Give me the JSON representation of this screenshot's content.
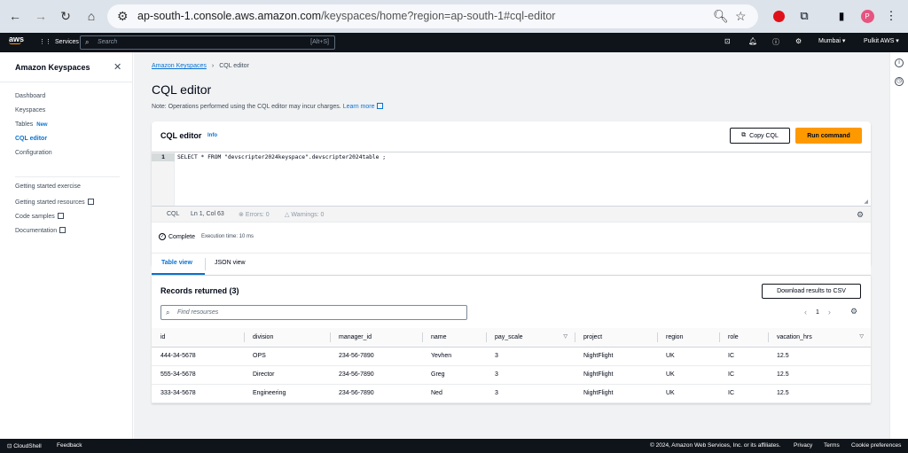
{
  "browser": {
    "url_host": "ap-south-1.console.aws.amazon.com",
    "url_path": "/keyspaces/home?region=ap-south-1#cql-editor",
    "profile_initial": "P"
  },
  "awsnav": {
    "logo": "aws",
    "services_label": "Services",
    "search_placeholder": "Search",
    "search_shortcut": "[Alt+S]",
    "region": "Mumbai ▾",
    "account": "Pulkit AWS ▾"
  },
  "sidepanel": {
    "title": "Amazon Keyspaces",
    "items": [
      {
        "label": "Dashboard"
      },
      {
        "label": "Keyspaces"
      },
      {
        "label": "Tables",
        "badge": "New"
      },
      {
        "label": "CQL editor"
      },
      {
        "label": "Configuration"
      }
    ],
    "links": [
      {
        "label": "Getting started exercise"
      },
      {
        "label": "Getting started resources"
      },
      {
        "label": "Code samples"
      },
      {
        "label": "Documentation"
      }
    ]
  },
  "breadcrumb": {
    "parent": "Amazon Keyspaces",
    "current": "CQL editor"
  },
  "page": {
    "title": "CQL editor",
    "note": "Note: Operations performed using the CQL editor may incur charges.",
    "learn_more": "Learn more"
  },
  "editor": {
    "title": "CQL editor",
    "info": "Info",
    "copy_label": "Copy CQL",
    "run_label": "Run command",
    "line_number": "1",
    "code": "SELECT * FROM \"devscripter2024keyspace\".devscripter2024table ;",
    "lang": "CQL",
    "position": "Ln 1, Col 63",
    "errors": "Errors: 0",
    "warnings": "Warnings: 0"
  },
  "result": {
    "status": "Complete",
    "execution": "Execution time: 10 ms"
  },
  "tabs": [
    {
      "label": "Table view"
    },
    {
      "label": "JSON view"
    }
  ],
  "records": {
    "title": "Records returned (3)",
    "download_label": "Download results to CSV",
    "find_placeholder": "Find resourses",
    "page": "1",
    "columns": [
      "id",
      "division",
      "manager_id",
      "name",
      "pay_scale",
      "project",
      "region",
      "role",
      "vacation_hrs"
    ],
    "rows": [
      [
        "444-34-5678",
        "OPS",
        "234-56-7890",
        "Yevhen",
        "3",
        "NightFlight",
        "UK",
        "IC",
        "12.5"
      ],
      [
        "555-34-5678",
        "Director",
        "234-56-7890",
        "Greg",
        "3",
        "NightFlight",
        "UK",
        "IC",
        "12.5"
      ],
      [
        "333-34-5678",
        "Engineering",
        "234-56-7890",
        "Ned",
        "3",
        "NightFlight",
        "UK",
        "IC",
        "12.5"
      ]
    ]
  },
  "footer": {
    "cloudshell": "CloudShell",
    "feedback": "Feedback",
    "copyright": "© 2024, Amazon Web Services, Inc. or its affiliates.",
    "privacy": "Privacy",
    "terms": "Terms",
    "cookies": "Cookie preferences"
  }
}
